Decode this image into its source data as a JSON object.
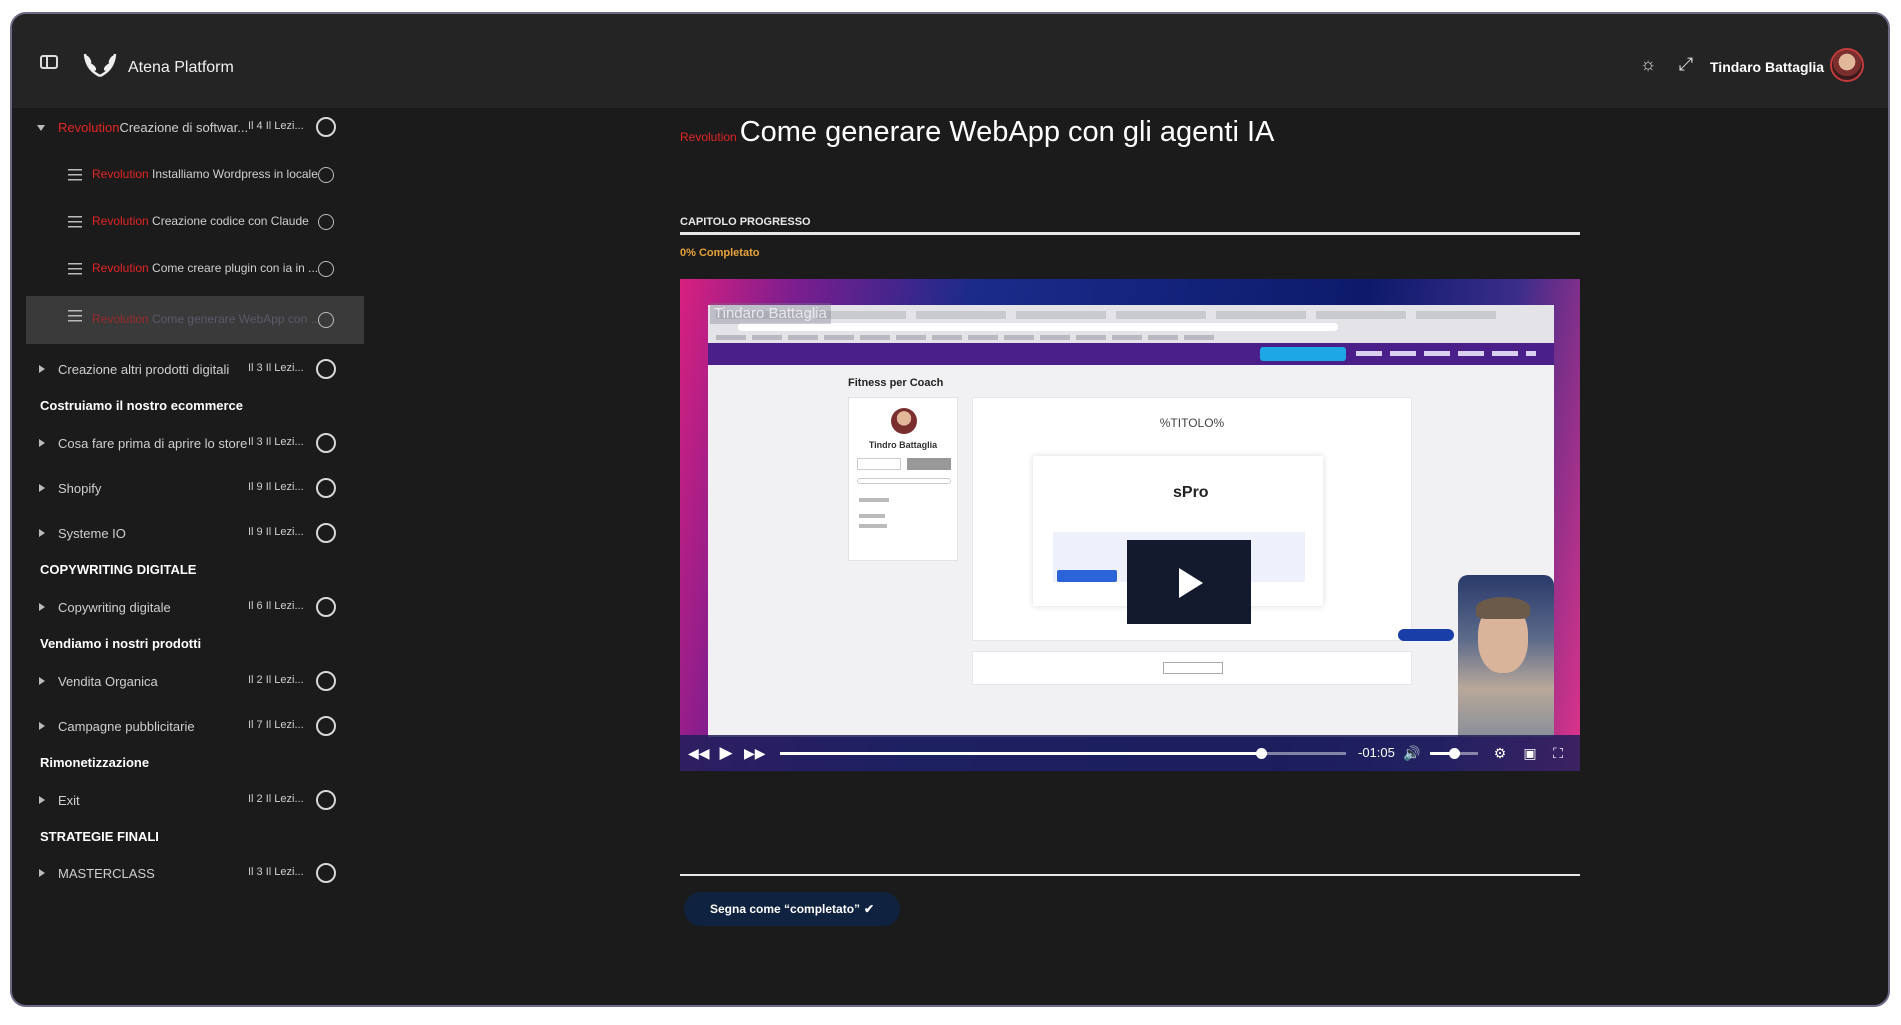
{
  "app": {
    "brand": "Atena Platform",
    "user_name": "Tindaro Battaglia"
  },
  "header": {
    "icons": [
      "sidebar-toggle-icon",
      "laurel-logo-icon",
      "sun-icon",
      "expand-icon"
    ]
  },
  "sidebar": {
    "rows": [
      {
        "kind": "module",
        "open": true,
        "tag": "Revolution",
        "title": "Creazione di softwar...",
        "meta": "Il 4 Il Lezi..."
      },
      {
        "kind": "lesson",
        "tag": "Revolution",
        "title": "Installiamo Wordpress in locale"
      },
      {
        "kind": "lesson",
        "tag": "Revolution",
        "title": "Creazione codice con Claude"
      },
      {
        "kind": "lesson",
        "tag": "Revolution",
        "title": "Come creare plugin con ia in ..."
      },
      {
        "kind": "lesson",
        "active": true,
        "tag": "Revolution",
        "title": "Come generare WebApp con ..."
      },
      {
        "kind": "module",
        "title": "Creazione altri prodotti digitali",
        "meta": "Il 3 Il Lezi..."
      },
      {
        "kind": "section",
        "title": "Costruiamo il nostro ecommerce"
      },
      {
        "kind": "module",
        "title": "Cosa fare prima di aprire lo store",
        "meta": "Il 3 Il Lezi..."
      },
      {
        "kind": "module",
        "title": "Shopify",
        "meta": "Il 9 Il Lezi..."
      },
      {
        "kind": "module",
        "title": "Systeme IO",
        "meta": "Il 9 Il Lezi..."
      },
      {
        "kind": "section",
        "title": "COPYWRITING DIGITALE"
      },
      {
        "kind": "module",
        "title": "Copywriting digitale",
        "meta": "Il 6 Il Lezi..."
      },
      {
        "kind": "section",
        "title": "Vendiamo i nostri prodotti"
      },
      {
        "kind": "module",
        "title": "Vendita Organica",
        "meta": "Il 2 Il Lezi..."
      },
      {
        "kind": "module",
        "title": "Campagne pubblicitarie",
        "meta": "Il 7 Il Lezi..."
      },
      {
        "kind": "section",
        "title": "Rimonetizzazione"
      },
      {
        "kind": "module",
        "title": "Exit",
        "meta": "Il 2 Il Lezi..."
      },
      {
        "kind": "section",
        "title": "STRATEGIE FINALI"
      },
      {
        "kind": "module",
        "title": "MASTERCLASS",
        "meta": "Il 3 Il Lezi..."
      }
    ]
  },
  "lesson": {
    "tag": "Revolution",
    "title": "Come generare WebApp con gli agenti IA",
    "progress_label": "CAPITOLO PROGRESSO",
    "progress_text": "0% Completato",
    "progress_value": 0,
    "mark_complete_label": "Segna come “completato”"
  },
  "video": {
    "watermark": "Tindaro Battaglia",
    "inner_heading": "Fitness per Coach",
    "inner_user": "Tindro Battaglia",
    "inner_placeholder": "%TITOLO%",
    "inner_product": "sPro",
    "time_remaining": "-01:05",
    "played_fraction": 0.85,
    "volume_fraction": 0.5
  },
  "colors": {
    "accent_red": "#e22424",
    "progress_orange": "#e8a33b",
    "button_navy": "#0f2240"
  }
}
